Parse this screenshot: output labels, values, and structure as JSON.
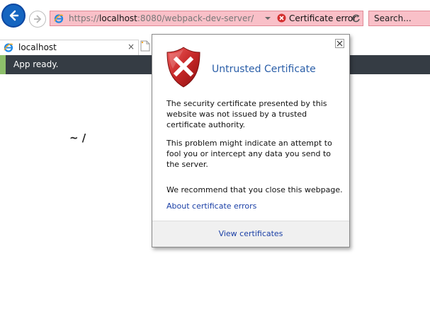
{
  "toolbar": {
    "url_scheme": "https://",
    "url_host": "localhost",
    "url_rest": ":8080/webpack-dev-server/",
    "cert_error_label": "Certificate error",
    "search_placeholder": "Search..."
  },
  "tabs": [
    {
      "label": "localhost",
      "close": "×"
    }
  ],
  "status": {
    "text": "App ready.",
    "accent_color": "#8dbf6b",
    "bar_color": "#353c44"
  },
  "page": {
    "heading": "~ /"
  },
  "cert_popup": {
    "title": "Untrusted Certificate",
    "paragraph_1": "The security certificate presented by this website was not issued by a trusted certificate authority.",
    "paragraph_2": "This problem might indicate an attempt to fool you or intercept any data you send to the server.",
    "recommendation": "We recommend that you close this webpage.",
    "link": "About certificate errors",
    "footer_button": "View certificates",
    "title_color": "#2a5ea8",
    "link_color": "#1a3fa6"
  },
  "colors": {
    "address_bar_error": "#f9c0c8",
    "back_button": "#1565c0"
  },
  "icons": {
    "back": "back-arrow-icon",
    "forward": "forward-arrow-icon",
    "browser": "ie-logo-icon",
    "cert_error": "cert-error-icon",
    "refresh": "refresh-icon",
    "warning": "shield-error-icon",
    "close": "close-icon"
  }
}
